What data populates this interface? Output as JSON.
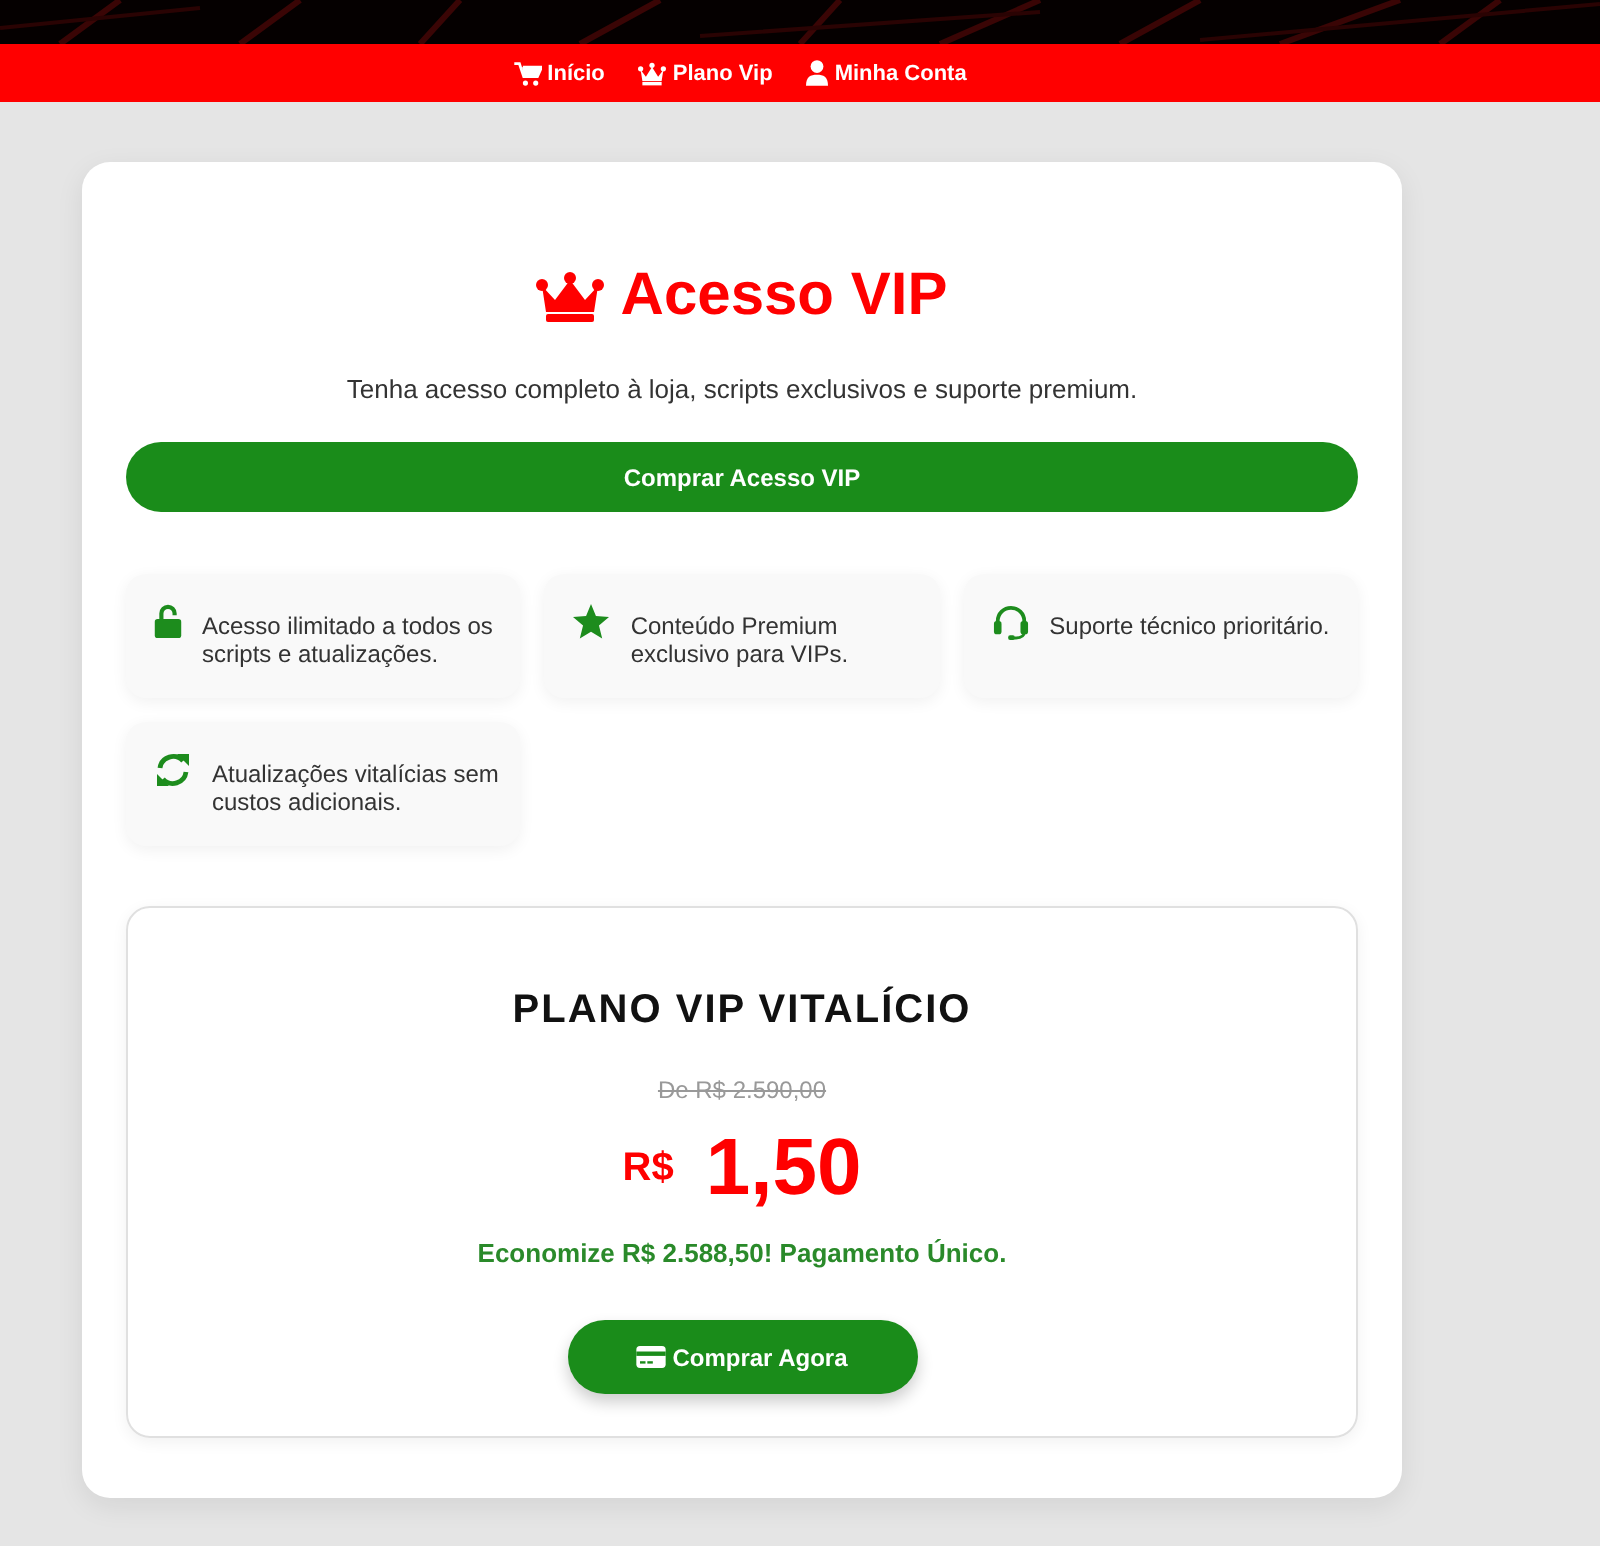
{
  "nav": [
    {
      "label": "Início"
    },
    {
      "label": "Plano Vip"
    },
    {
      "label": "Minha Conta"
    }
  ],
  "hero": {
    "title": "Acesso VIP",
    "subtitle": "Tenha acesso completo à loja, scripts exclusivos e suporte premium.",
    "button": "Comprar Acesso VIP"
  },
  "features": [
    {
      "text": "Acesso ilimitado a todos os scripts e atualizações."
    },
    {
      "text": "Conteúdo Premium exclusivo para VIPs."
    },
    {
      "text": "Suporte técnico prioritário."
    },
    {
      "text": "Atualizações vitalícias sem custos adicionais."
    }
  ],
  "plan": {
    "title": "PLANO VIP VITALÍCIO",
    "old_price": "De R$ 2.590,00",
    "currency": "R$",
    "price": "1,50",
    "savings": "Economize R$ 2.588,50! Pagamento Único.",
    "button": "Comprar Agora"
  }
}
